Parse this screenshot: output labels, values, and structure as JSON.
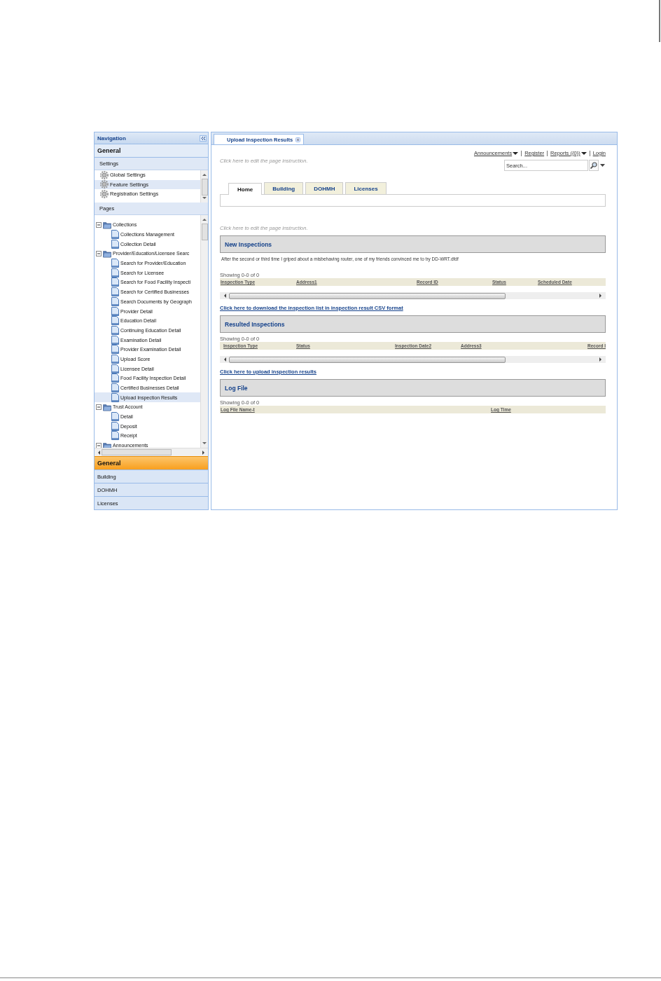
{
  "nav": {
    "title": "Navigation",
    "section": "General",
    "settings_label": "Settings",
    "settings_items": [
      {
        "label": "Global Settings",
        "selected": false
      },
      {
        "label": "Feature Settings",
        "selected": true
      },
      {
        "label": "Registration Settings",
        "selected": false
      }
    ],
    "pages_label": "Pages",
    "tree": [
      {
        "label": "Collections",
        "expanded": true,
        "children": [
          {
            "label": "Collections Management",
            "selected": false
          },
          {
            "label": "Collection Detail",
            "selected": false
          }
        ]
      },
      {
        "label": "Provider/Education/Licensee Searc",
        "expanded": true,
        "children": [
          {
            "label": "Search for Provider/Education",
            "selected": false
          },
          {
            "label": "Search for Licensee",
            "selected": false
          },
          {
            "label": "Search for Food Facility Inspecti",
            "selected": false
          },
          {
            "label": "Search for Certified Businesses",
            "selected": false
          },
          {
            "label": "Search Documents by Geograph",
            "selected": false
          },
          {
            "label": "Provider Detail",
            "selected": false
          },
          {
            "label": "Education Detail",
            "selected": false
          },
          {
            "label": "Continuing Education Detail",
            "selected": false
          },
          {
            "label": "Examination Detail",
            "selected": false
          },
          {
            "label": "Provider Examination Detail",
            "selected": false
          },
          {
            "label": "Upload Score",
            "selected": false
          },
          {
            "label": "Licensee Detail",
            "selected": false
          },
          {
            "label": "Food Facility Inspection Detail",
            "selected": false
          },
          {
            "label": "Certified Businesses Detail",
            "selected": false
          },
          {
            "label": "Upload Inspection Results",
            "selected": true
          }
        ]
      },
      {
        "label": "Trust Account",
        "expanded": true,
        "children": [
          {
            "label": "Detail",
            "selected": false
          },
          {
            "label": "Deposit",
            "selected": false
          },
          {
            "label": "Receipt",
            "selected": false
          }
        ]
      },
      {
        "label": "Announcements",
        "expanded": true
      }
    ],
    "accordion": [
      {
        "label": "General",
        "selected": true
      },
      {
        "label": "Building",
        "selected": false
      },
      {
        "label": "DOHMH",
        "selected": false
      },
      {
        "label": "Licenses",
        "selected": false
      }
    ]
  },
  "main": {
    "tab": {
      "title": "Upload Inspection Results"
    },
    "top_links": [
      {
        "label": "Announcements",
        "kind": "dropdown"
      },
      {
        "label": "Register",
        "kind": "link"
      },
      {
        "label": "Reports ({0})",
        "kind": "dropdown"
      },
      {
        "label": "Login",
        "kind": "link"
      }
    ],
    "instruction": "Click here to edit the page instruction.",
    "search": {
      "placeholder": "Search..."
    },
    "tabs": [
      {
        "label": "Home",
        "selected": true
      },
      {
        "label": "Building",
        "selected": false
      },
      {
        "label": "DOHMH",
        "selected": false
      },
      {
        "label": "Licenses",
        "selected": false
      }
    ],
    "instruction_2": "Click here to edit the page instruction.",
    "sections": [
      {
        "title": "New Inspections",
        "description": "After the second or third time I griped about a misbehaving router, one of my friends convinced me to try DD-WRT.dfdf",
        "showing": "Showing 0-0 of 0",
        "columns": [
          "Inspection Type",
          "Address1",
          "Record ID",
          "Status",
          "Scheduled Date"
        ],
        "scrollbar": true,
        "link": "Click here to download the inspection list in inspection result CSV format"
      },
      {
        "title": "Resulted Inspections",
        "showing": "Showing 0-0 of 0",
        "columns": [
          "Inspection Type",
          "Status",
          "Inspection Date2",
          "Address3",
          "Record I"
        ],
        "scrollbar": true,
        "link": "Click here to upload inspection results"
      },
      {
        "title": "Log File",
        "showing": "Showing 0-0 of 0",
        "columns": [
          "Log File Name-t",
          "Log Time"
        ],
        "scrollbar": false
      }
    ]
  }
}
